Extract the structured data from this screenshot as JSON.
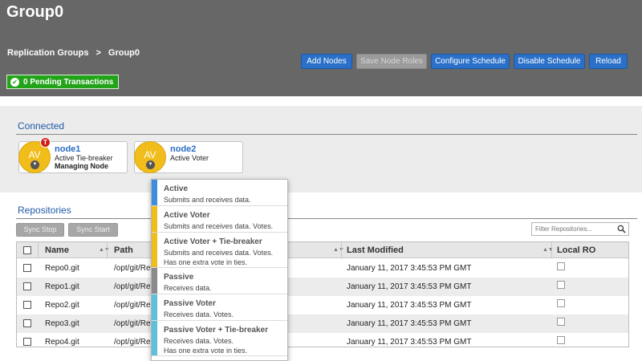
{
  "header": {
    "title": "Group0",
    "breadcrumb": {
      "root": "Replication Groups",
      "separator": ">",
      "current": "Group0"
    },
    "pending": "0 Pending Transactions"
  },
  "toolbar": {
    "add_nodes": "Add Nodes",
    "save_node_roles": "Save Node Roles",
    "configure_schedule": "Configure Schedule",
    "disable_schedule": "Disable Schedule",
    "reload": "Reload"
  },
  "connected": {
    "title": "Connected",
    "nodes": [
      {
        "avatar": "AV",
        "badge": "T",
        "name": "node1",
        "role": "Active Tie-breaker",
        "extra": "Managing Node"
      },
      {
        "avatar": "AV",
        "name": "node2",
        "role": "Active Voter"
      }
    ]
  },
  "repositories": {
    "title": "Repositories",
    "sync_stop": "Sync Stop",
    "sync_start": "Sync Start",
    "filter_placeholder": "Filter Repositories...",
    "columns": {
      "name": "Name",
      "path": "Path",
      "last_modified": "Last Modified",
      "local_ro": "Local RO"
    },
    "rows": [
      {
        "name": "Repo0.git",
        "path": "/opt/git/Re",
        "modified": "January 11, 2017 3:45:53 PM GMT"
      },
      {
        "name": "Repo1.git",
        "path": "/opt/git/Re",
        "modified": "January 11, 2017 3:45:53 PM GMT"
      },
      {
        "name": "Repo2.git",
        "path": "/opt/git/Re",
        "modified": "January 11, 2017 3:45:53 PM GMT"
      },
      {
        "name": "Repo3.git",
        "path": "/opt/git/Re",
        "modified": "January 11, 2017 3:45:53 PM GMT"
      },
      {
        "name": "Repo4.git",
        "path": "/opt/git/Re",
        "modified": "January 11, 2017 3:45:53 PM GMT"
      }
    ]
  },
  "role_menu": {
    "options": [
      {
        "title": "Active",
        "desc1": "Submits and receives data.",
        "color": "#3f8de0"
      },
      {
        "title": "Active Voter",
        "desc1": "Submits and receives data. Votes.",
        "color": "#f1bd1a"
      },
      {
        "title": "Active Voter + Tie-breaker",
        "desc1": "Submits and receives data. Votes.",
        "desc2": "Has one extra vote in ties.",
        "color": "#f1bd1a"
      },
      {
        "title": "Passive",
        "desc1": "Receives data.",
        "color": "#8a8a8a"
      },
      {
        "title": "Passive Voter",
        "desc1": "Receives data. Votes.",
        "color": "#5bc0d8"
      },
      {
        "title": "Passive Voter + Tie-breaker",
        "desc1": "Receives data. Votes.",
        "desc2": "Has one extra vote in ties.",
        "color": "#5bc0d8"
      }
    ]
  }
}
